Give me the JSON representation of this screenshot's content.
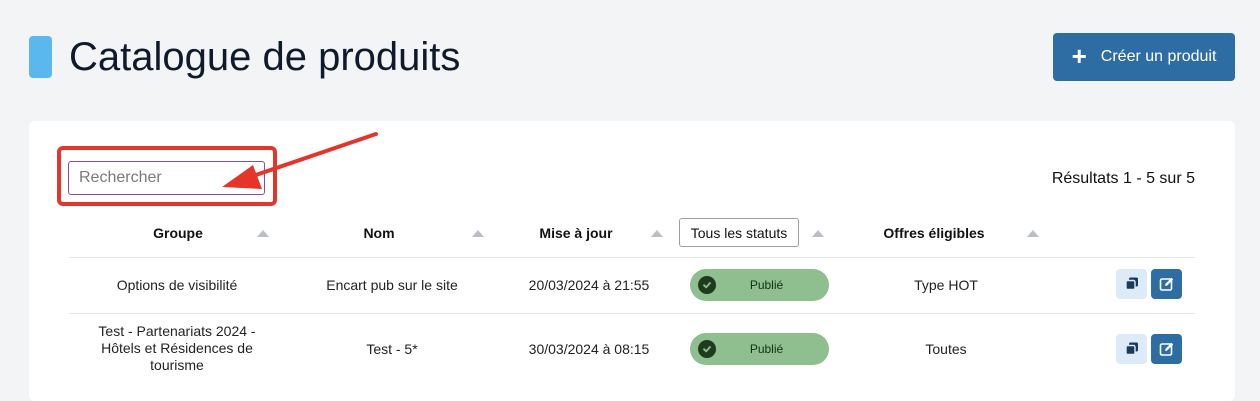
{
  "header": {
    "title": "Catalogue de produits",
    "create_label": "Créer un produit",
    "accent_color": "#5bb8ef",
    "primary_color": "#2e6da4"
  },
  "search": {
    "placeholder": "Rechercher",
    "value": ""
  },
  "results_text": "Résultats 1 - 5 sur 5",
  "table": {
    "columns": {
      "group": "Groupe",
      "name": "Nom",
      "updated": "Mise à jour",
      "status_filter": "Tous les statuts",
      "offers": "Offres éligibles"
    },
    "rows": [
      {
        "group": "Options de visibilité",
        "name": "Encart pub sur le site",
        "updated": "20/03/2024 à 21:55",
        "status": "Publié",
        "offers": "Type HOT"
      },
      {
        "group": "Test - Partenariats 2024 - Hôtels et Résidences de tourisme",
        "name": "Test - 5*",
        "updated": "30/03/2024 à 08:15",
        "status": "Publié",
        "offers": "Toutes"
      }
    ]
  },
  "icons": {
    "create": "plus-icon",
    "status": "check-circle-icon",
    "duplicate": "copy-icon",
    "edit": "edit-icon",
    "sort": "sort-arrow-icon"
  },
  "annotation_color": "#e5352b"
}
